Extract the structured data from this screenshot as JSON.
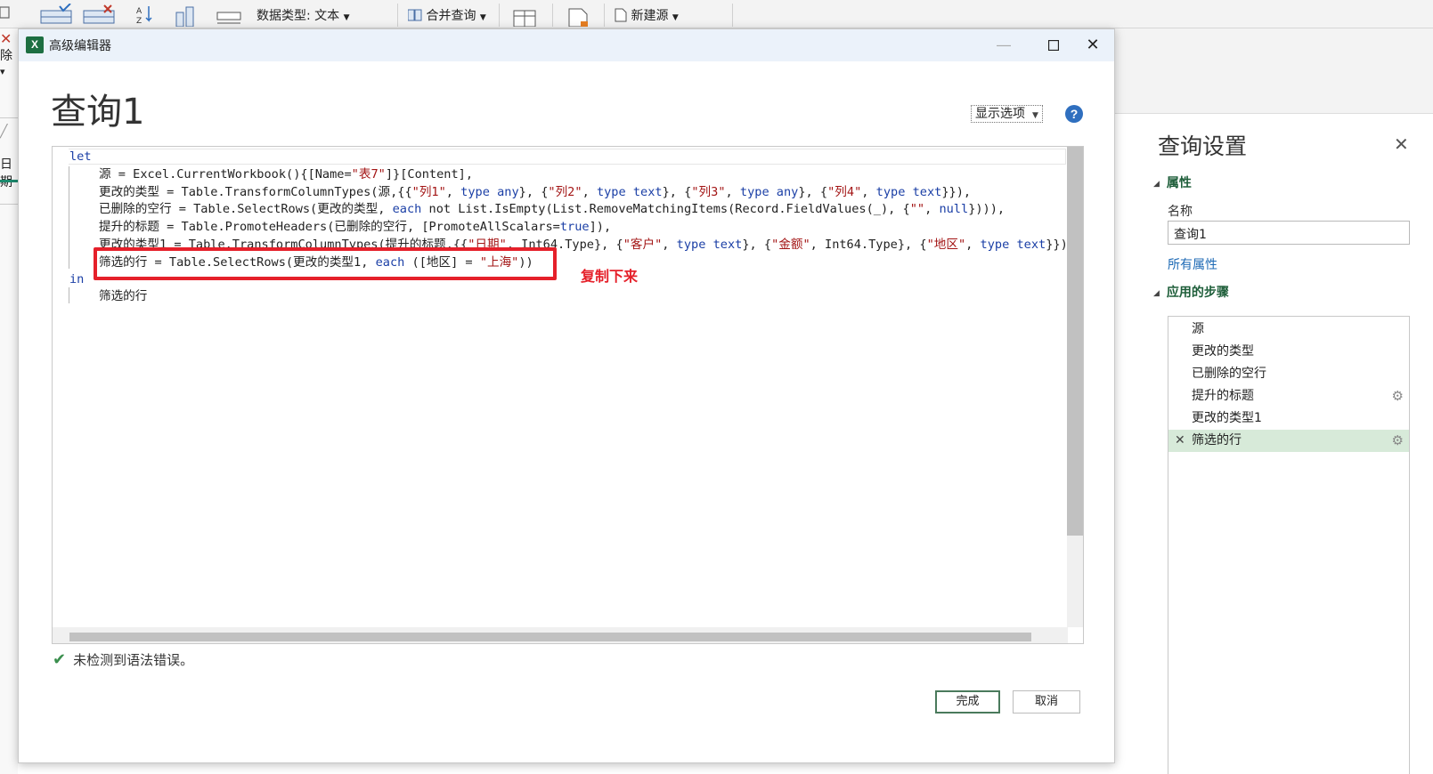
{
  "ribbon": {
    "data_type_label": "数据类型: 文本",
    "merge_queries_label": "合并查询",
    "new_source_label": "新建源",
    "left_fragment_1": "除",
    "left_fragment_2": "日期"
  },
  "dialog": {
    "title": "高级编辑器",
    "query_name": "查询1",
    "display_options_label": "显示选项",
    "help_symbol": "?",
    "status_text": "未检测到语法错误。",
    "done_label": "完成",
    "cancel_label": "取消",
    "annotation_text": "复制下来"
  },
  "code": {
    "kw_let": "let",
    "l1_a": "源 = Excel.CurrentWorkbook(){[Name=",
    "l1_s1": "\"表7\"",
    "l1_b": "]}[Content],",
    "l2_a": "更改的类型 = Table.TransformColumnTypes(源,{{",
    "l2_s1": "\"列1\"",
    "l2_b": ", ",
    "l2_k1": "type any",
    "l2_c": "}, {",
    "l2_s2": "\"列2\"",
    "l2_d": ", ",
    "l2_k2": "type text",
    "l2_e": "}, {",
    "l2_s3": "\"列3\"",
    "l2_f": ", ",
    "l2_k3": "type any",
    "l2_g": "}, {",
    "l2_s4": "\"列4\"",
    "l2_h": ", ",
    "l2_k4": "type text",
    "l2_i": "}}),",
    "l3_a": "已删除的空行 = Table.SelectRows(更改的类型, ",
    "l3_k1": "each",
    "l3_b": " not List.IsEmpty(List.RemoveMatchingItems(Record.FieldValues(_), {",
    "l3_s1": "\"\"",
    "l3_c": ", ",
    "l3_k2": "null",
    "l3_d": "}))),",
    "l4_a": "提升的标题 = Table.PromoteHeaders(已删除的空行, [PromoteAllScalars=",
    "l4_k1": "true",
    "l4_b": "]),",
    "l5_a": "更改的类型1 = Table.TransformColumnTypes(提升的标题,{{",
    "l5_s1": "\"日期\"",
    "l5_b": ", Int64.Type}, {",
    "l5_s2": "\"客户\"",
    "l5_c": ", ",
    "l5_k1": "type text",
    "l5_d": "}, {",
    "l5_s3": "\"金额\"",
    "l5_e": ", Int64.Type}, {",
    "l5_s4": "\"地区\"",
    "l5_f": ", ",
    "l5_k2": "type text",
    "l5_g": "}}),",
    "l6_a": "筛选的行 = Table.SelectRows(更改的类型1, ",
    "l6_k1": "each",
    "l6_b": " ([地区] = ",
    "l6_s1": "\"上海\"",
    "l6_c": "))",
    "kw_in": "in",
    "l8": "筛选的行"
  },
  "query_settings": {
    "title": "查询设置",
    "properties_label": "属性",
    "name_label": "名称",
    "name_value": "查询1",
    "all_properties_link": "所有属性",
    "applied_steps_label": "应用的步骤",
    "steps": [
      {
        "label": "源"
      },
      {
        "label": "更改的类型"
      },
      {
        "label": "已删除的空行"
      },
      {
        "label": "提升的标题"
      },
      {
        "label": "更改的类型1"
      },
      {
        "label": "筛选的行"
      }
    ]
  },
  "colors": {
    "accent_green": "#1e5e3a",
    "highlight_red": "#e5202a",
    "selected_step_bg": "#d7ead9",
    "keyword_blue": "#1b3fa6",
    "string_red": "#a31515"
  }
}
